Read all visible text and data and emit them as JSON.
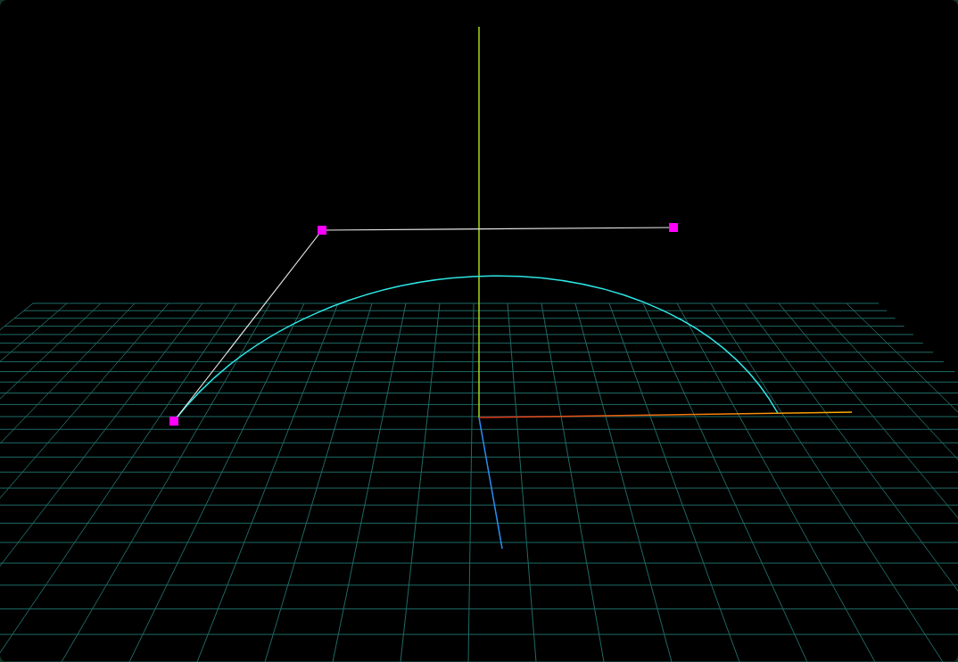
{
  "viewport": {
    "kind": "curve-editor"
  }
}
